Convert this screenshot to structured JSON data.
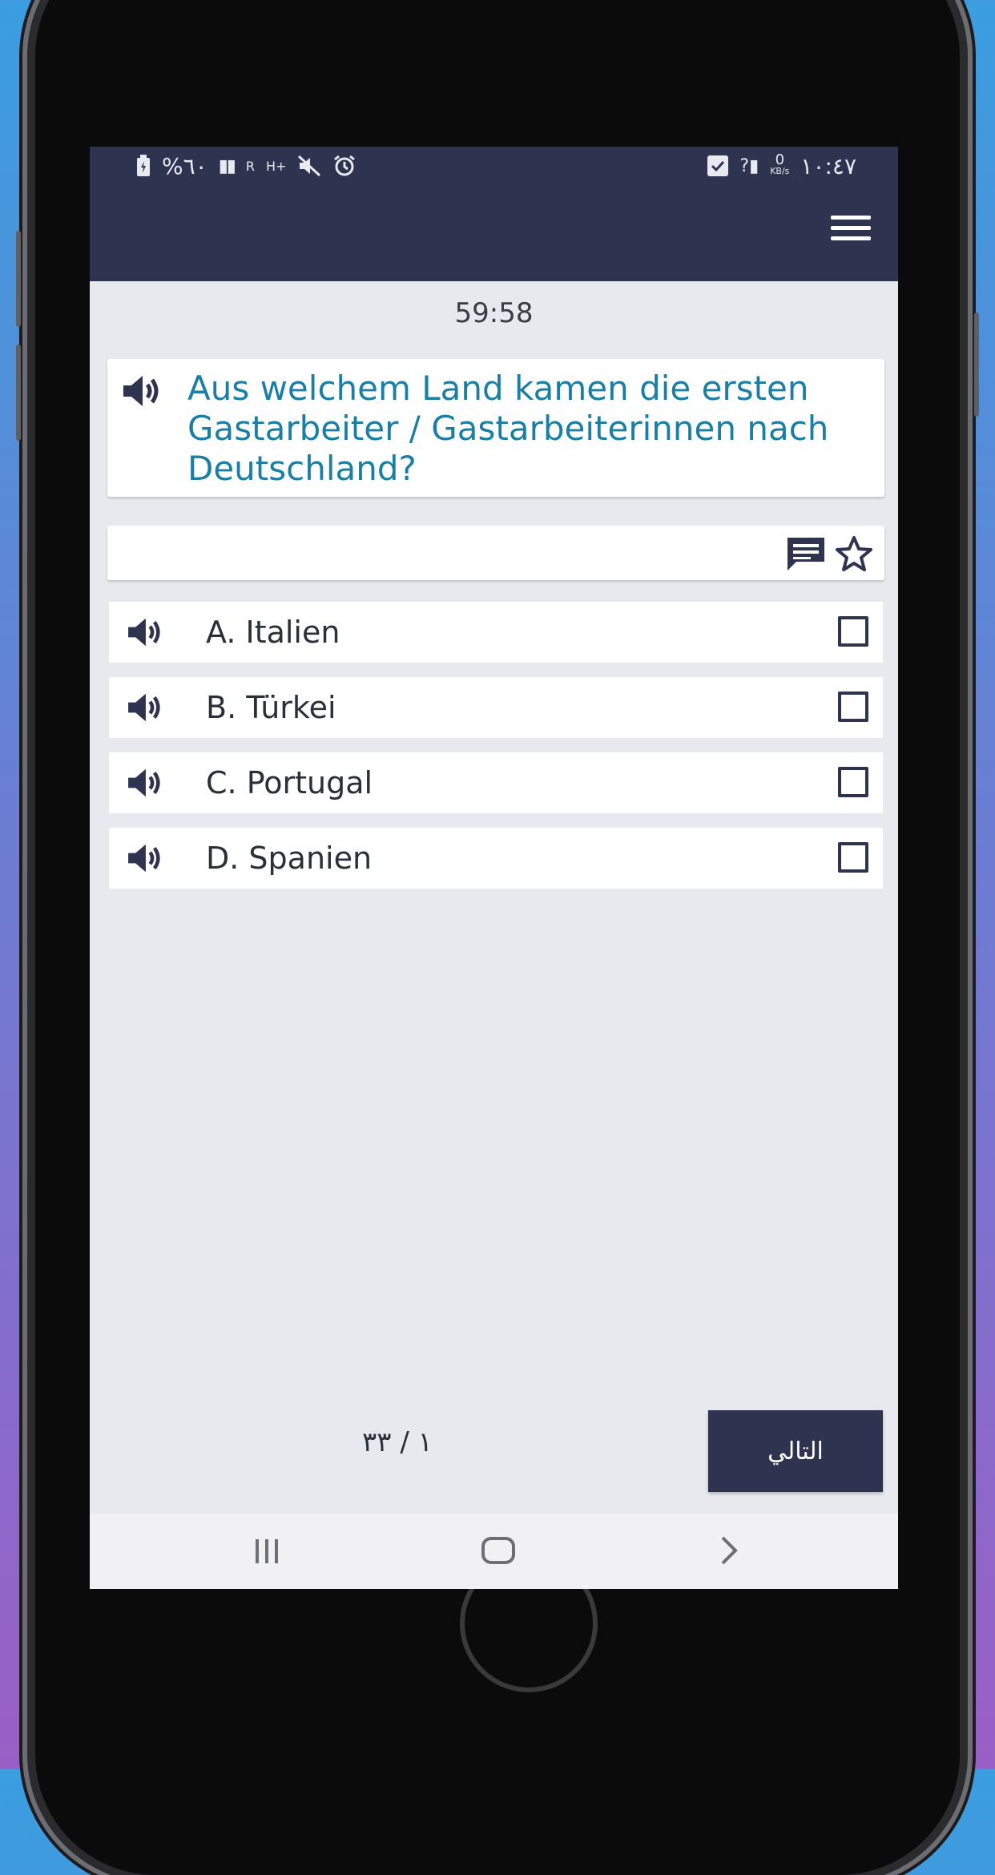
{
  "status_bar": {
    "time": "١٠:٤٧",
    "data_rate_value": "0",
    "data_rate_unit": "KB/s",
    "battery": "%٦٠",
    "network": "H+",
    "roaming": "R"
  },
  "timer": "59:58",
  "question": {
    "text": "Aus welchem Land kamen die ersten Gastarbeiter / Gastarbeiterinnen nach Deutschland?"
  },
  "options": [
    {
      "label": "A. Italien"
    },
    {
      "label": "B. Türkei"
    },
    {
      "label": "C. Portugal"
    },
    {
      "label": "D. Spanien"
    }
  ],
  "footer": {
    "progress": "١ / ٣٣",
    "next_label": "التالي"
  },
  "icons": {
    "menu": "hamburger-icon",
    "speaker": "speaker-icon",
    "comment": "chat-bubble-icon",
    "favorite": "star-outline-icon",
    "checkbox": "checkbox-empty-icon",
    "nav_recent": "recent-apps-icon",
    "nav_home": "home-icon",
    "nav_back": "back-icon"
  },
  "colors": {
    "app_bar": "#2e3450",
    "question_text": "#1a7fa3",
    "background": "#e8e9ee"
  }
}
